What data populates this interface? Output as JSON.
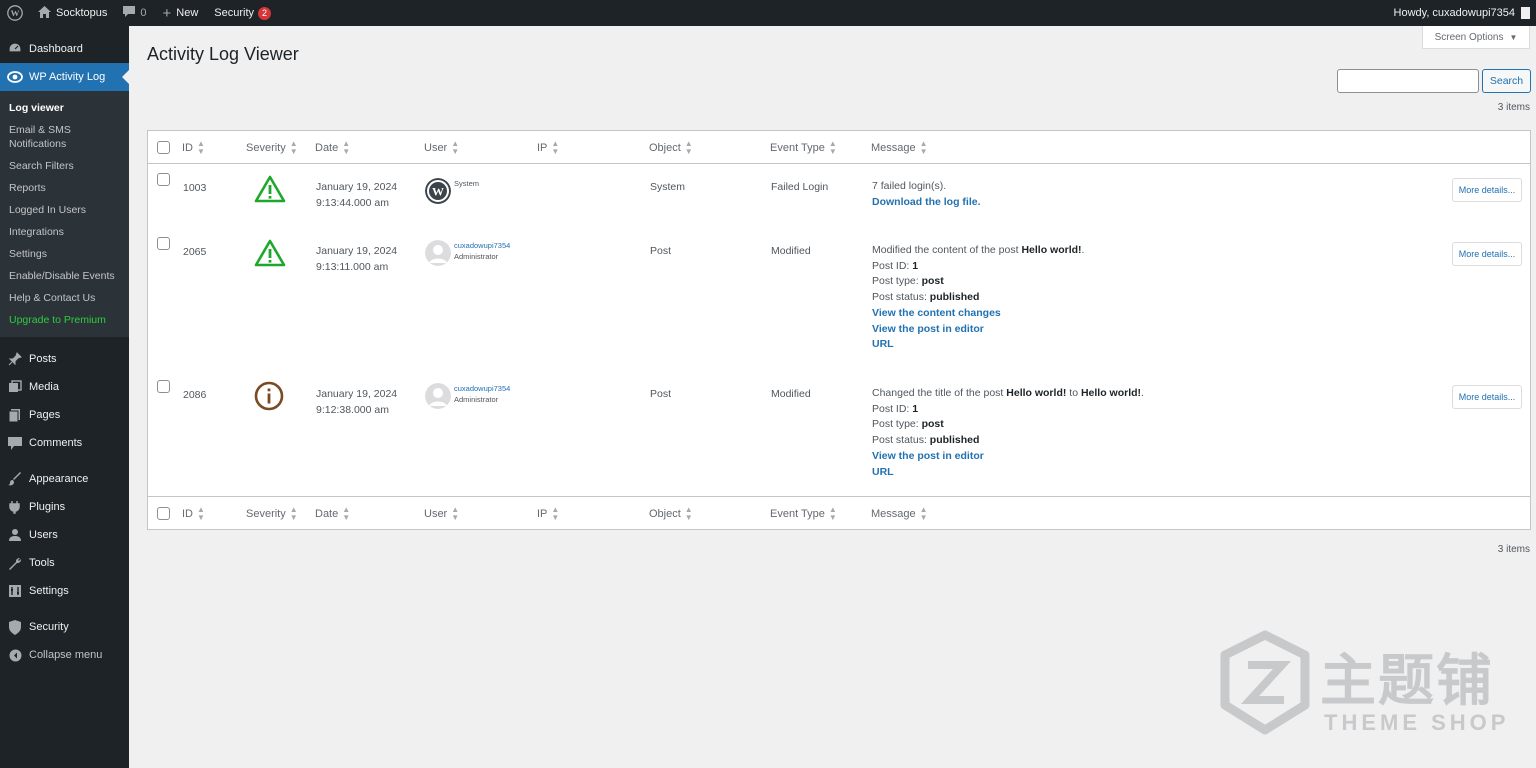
{
  "adminbar": {
    "site_name": "Socktopus",
    "comments_count": "0",
    "new_label": "New",
    "security_label": "Security",
    "security_badge": "2",
    "greeting": "Howdy, cuxadowupi7354"
  },
  "sidebar": {
    "dashboard": "Dashboard",
    "wp_activity_log": "WP Activity Log",
    "submenu": [
      "Log viewer",
      "Email & SMS Notifications",
      "Search Filters",
      "Reports",
      "Logged In Users",
      "Integrations",
      "Settings",
      "Enable/Disable Events",
      "Help & Contact Us",
      "Upgrade to Premium"
    ],
    "posts": "Posts",
    "media": "Media",
    "pages": "Pages",
    "comments": "Comments",
    "appearance": "Appearance",
    "plugins": "Plugins",
    "users": "Users",
    "tools": "Tools",
    "settings": "Settings",
    "security": "Security",
    "collapse": "Collapse menu"
  },
  "page": {
    "title": "Activity Log Viewer",
    "screen_options": "Screen Options",
    "search_button": "Search",
    "items_count": "3 items"
  },
  "table": {
    "columns": [
      "ID",
      "Severity",
      "Date",
      "User",
      "IP",
      "Object",
      "Event Type",
      "Message"
    ],
    "more_details": "More details...",
    "rows": [
      {
        "id": "1003",
        "severity": "warning",
        "date": "January 19, 2024",
        "time": "9:13:44.000 am",
        "user": "System",
        "role": "",
        "ip": "",
        "object": "System",
        "event_type": "Failed Login",
        "message_lines": [
          {
            "text": "7 failed login(s)."
          },
          {
            "link": "Download the log file."
          }
        ]
      },
      {
        "id": "2065",
        "severity": "warning",
        "date": "January 19, 2024",
        "time": "9:13:11.000 am",
        "user": "cuxadowupi7354",
        "role": "Administrator",
        "ip": "",
        "object": "Post",
        "event_type": "Modified",
        "message_lines": [
          {
            "text": "Modified the content of the post ",
            "bold": "Hello world!",
            "after": "."
          },
          {
            "text": "Post ID: ",
            "bold": "1"
          },
          {
            "text": "Post type: ",
            "bold": "post"
          },
          {
            "text": "Post status: ",
            "bold": "published"
          },
          {
            "link": "View the content changes"
          },
          {
            "link": "View the post in editor"
          },
          {
            "link": "URL"
          }
        ]
      },
      {
        "id": "2086",
        "severity": "info",
        "date": "January 19, 2024",
        "time": "9:12:38.000 am",
        "user": "cuxadowupi7354",
        "role": "Administrator",
        "ip": "",
        "object": "Post",
        "event_type": "Modified",
        "message_lines": [
          {
            "text": "Changed the title of the post ",
            "bold": "Hello world!",
            "mid": " to ",
            "bold2": "Hello world!",
            "after": "."
          },
          {
            "text": "Post ID: ",
            "bold": "1"
          },
          {
            "text": "Post type: ",
            "bold": "post"
          },
          {
            "text": "Post status: ",
            "bold": "published"
          },
          {
            "link": "View the post in editor"
          },
          {
            "link": "URL"
          }
        ]
      }
    ]
  },
  "watermark": {
    "cn": "主题铺",
    "en": "THEME SHOP"
  },
  "colors": {
    "admin_dark": "#1d2327",
    "accent": "#2271b1",
    "warning": "#1ea82b",
    "info": "#7a4a22",
    "premium": "#2ecc40"
  }
}
